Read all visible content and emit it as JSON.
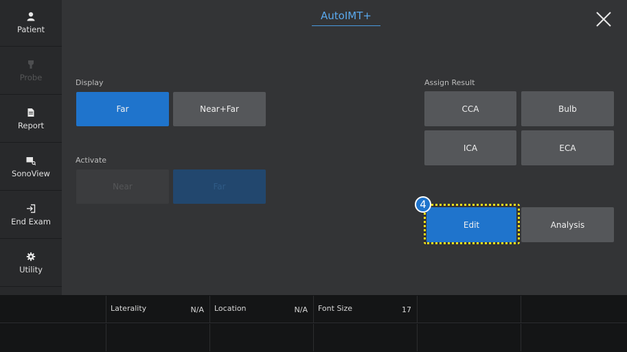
{
  "sidebar": {
    "items": [
      {
        "label": "Patient",
        "icon": "person-icon",
        "enabled": true
      },
      {
        "label": "Probe",
        "icon": "probe-icon",
        "enabled": false
      },
      {
        "label": "Report",
        "icon": "document-icon",
        "enabled": true
      },
      {
        "label": "SonoView",
        "icon": "sonoview-icon",
        "enabled": true
      },
      {
        "label": "End Exam",
        "icon": "exit-icon",
        "enabled": true
      },
      {
        "label": "Utility",
        "icon": "gear-icon",
        "enabled": true
      }
    ]
  },
  "header": {
    "title": "AutoIMT+",
    "close_icon": "close-icon"
  },
  "display": {
    "label": "Display",
    "buttons": [
      {
        "label": "Far",
        "active": true
      },
      {
        "label": "Near+Far",
        "active": false
      }
    ]
  },
  "activate": {
    "label": "Activate",
    "buttons": [
      {
        "label": "Near",
        "enabled": false
      },
      {
        "label": "Far",
        "enabled": false
      }
    ]
  },
  "assign_result": {
    "label": "Assign Result",
    "buttons": [
      {
        "label": "CCA"
      },
      {
        "label": "Bulb"
      },
      {
        "label": "ICA"
      },
      {
        "label": "ECA"
      }
    ]
  },
  "actions": {
    "edit_label": "Edit",
    "analysis_label": "Analysis",
    "step_badge": "4"
  },
  "status_bar": {
    "fields": [
      {
        "key": "Laterality",
        "value": "N/A"
      },
      {
        "key": "Location",
        "value": "N/A"
      },
      {
        "key": "Font Size",
        "value": "17"
      }
    ]
  },
  "colors": {
    "accent": "#1f74cc",
    "title": "#5aa9ee",
    "focus_ring": "#f4e21a",
    "background": "#333436",
    "sidebar": "#28292b"
  }
}
